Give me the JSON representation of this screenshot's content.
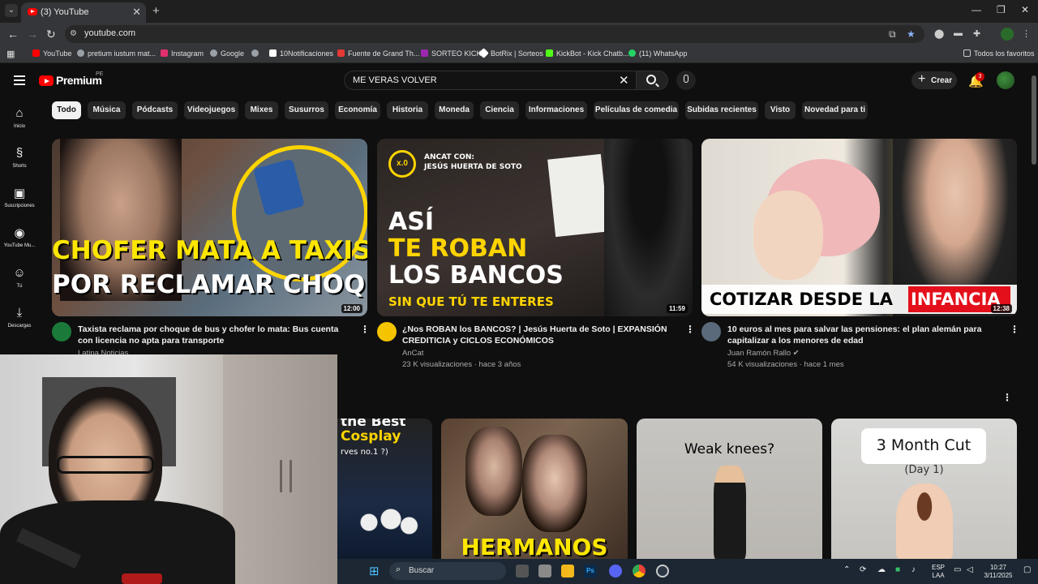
{
  "browser": {
    "tab_title": "(3) YouTube",
    "url": "youtube.com",
    "bookmarks": [
      {
        "label": "YouTube",
        "color": "#ff0000"
      },
      {
        "label": "pretium iustum mat...",
        "color": "#9aa0a6"
      },
      {
        "label": "Instagram",
        "color": "#e1306c"
      },
      {
        "label": "Google",
        "color": "#9aa0a6"
      },
      {
        "label": "",
        "color": "#9aa0a6"
      },
      {
        "label": "10Notificaciones",
        "color": "#ffffff"
      },
      {
        "label": "Fuente de Grand Th...",
        "color": "#e53935"
      },
      {
        "label": "SORTEO KICK",
        "color": "#9c27b0"
      },
      {
        "label": "BotRix | Sorteos",
        "color": "#ffffff"
      },
      {
        "label": "KickBot - Kick Chatb...",
        "color": "#53fc18"
      },
      {
        "label": "(11) WhatsApp",
        "color": "#25d366"
      }
    ],
    "all_bookmarks": "Todos los favoritos"
  },
  "youtube": {
    "logo_text": "Premium",
    "country": "PE",
    "search_query": "ME VERAS VOLVER",
    "create_label": "Crear",
    "notification_count": "3",
    "sidebar": [
      {
        "icon": "home-icon",
        "glyph": "⌂",
        "label": "Inicio"
      },
      {
        "icon": "shorts-icon",
        "glyph": "§",
        "label": "Shorts"
      },
      {
        "icon": "subscriptions-icon",
        "glyph": "▣",
        "label": "Suscripciones"
      },
      {
        "icon": "youtube-music-icon",
        "glyph": "◉",
        "label": "YouTube Mu..."
      },
      {
        "icon": "you-icon",
        "glyph": "☺",
        "label": "Tú"
      },
      {
        "icon": "downloads-icon",
        "glyph": "⤓",
        "label": "Descargas"
      }
    ],
    "chips": [
      "Todo",
      "Música",
      "Pódcasts",
      "Videojuegos",
      "Mixes",
      "Susurros",
      "Economía",
      "Historia",
      "Moneda",
      "Ciencia",
      "Informaciones",
      "Películas de comedia",
      "Subidas recientes",
      "Visto",
      "Novedad para ti"
    ],
    "videos": [
      {
        "title": "Taxista reclama por choque de bus y chofer lo mata: Bus cuenta con licencia no apta para transporte",
        "channel": "Latina Noticias",
        "meta": "",
        "duration": "12:00",
        "thumb_lines": [
          "CHOFER MATA A TAXISTA",
          "POR RECLAMAR CHOQUE"
        ]
      },
      {
        "title": "¿Nos ROBAN los BANCOS? | Jesús Huerta de Soto | EXPANSIÓN CREDITICIA y CICLOS ECONÓMICOS",
        "channel": "AnCat",
        "meta": "23 K visualizaciones · hace 3 años",
        "duration": "11:59",
        "thumb_header": "ANCAT CON:",
        "thumb_header2": "JESÚS HUERTA DE SOTO",
        "thumb_lines": [
          "ASÍ",
          "TE ROBAN",
          "LOS BANCOS",
          "SIN QUE TÚ TE ENTERES"
        ]
      },
      {
        "title": "10 euros al mes para salvar las pensiones: el plan alemán para capitalizar a los menores de edad",
        "channel": "Juan Ramón Rallo",
        "meta": "54 K visualizaciones · hace 1 mes",
        "duration": "12:38",
        "thumb_lines": [
          "COTIZAR DESDE LA",
          "INFANCIA"
        ]
      }
    ],
    "shorts": [
      {
        "text": "the Best",
        "text2": "Cosplay",
        "text3": "rves no.1 ?)"
      },
      {
        "text": "HERMANOS"
      },
      {
        "text": "Weak knees?"
      },
      {
        "text": "3 Month Cut",
        "text2": "(Day 1)"
      }
    ]
  },
  "taskbar": {
    "search_placeholder": "Buscar",
    "lang_line1": "ESP",
    "lang_line2": "LAA",
    "time": "10:27",
    "date": "3/11/2025"
  }
}
